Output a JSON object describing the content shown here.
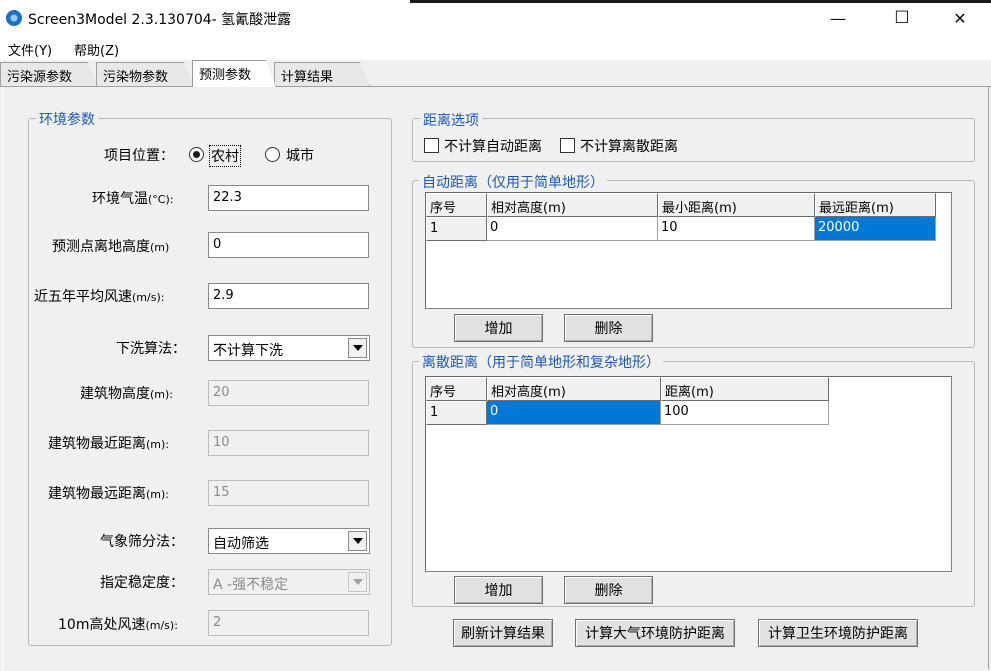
{
  "window": {
    "title": "Screen3Model 2.3.130704- 氢氰酸泄露"
  },
  "window_controls": {
    "minimize": "—",
    "maximize": "☐",
    "close": "✕"
  },
  "menu": [
    {
      "label": "文件(Y)"
    },
    {
      "label": "帮助(Z)"
    }
  ],
  "tabs": [
    {
      "label": "污染源参数"
    },
    {
      "label": "污染物参数"
    },
    {
      "label": "预测参数"
    },
    {
      "label": "计算结果"
    }
  ],
  "active_tab": "预测参数",
  "env_params": {
    "title": "环境参数",
    "location_label": "项目位置：",
    "location_options": [
      {
        "label": "农村",
        "selected": true
      },
      {
        "label": "城市",
        "selected": false
      }
    ],
    "temp_label": "环境气温",
    "temp_unit": "(°C):",
    "temp_value": "22.3",
    "height_label": "预测点离地高度",
    "height_unit": "(m)",
    "height_value": "0",
    "wind_label": "近五年平均风速",
    "wind_unit": "(m/s):",
    "wind_value": "2.9",
    "downwash_label": "下洗算法：",
    "downwash_value": "不计算下洗",
    "bldg_height_label": "建筑物高度",
    "bldg_height_unit": "(m):",
    "bldg_height_value": "20",
    "bldg_near_label": "建筑物最近距离",
    "bldg_near_unit": "(m):",
    "bldg_near_value": "10",
    "bldg_far_label": "建筑物最远距离",
    "bldg_far_unit": "(m):",
    "bldg_far_value": "15",
    "met_label": "气象筛分法：",
    "met_value": "自动筛选",
    "stability_label": "指定稳定度：",
    "stability_value": "A -强不稳定",
    "wind10_label": "10m高处风速",
    "wind10_unit": "(m/s):",
    "wind10_value": "2"
  },
  "distance_options": {
    "title": "距离选项",
    "no_auto_label": "不计算自动距离",
    "no_auto_checked": false,
    "no_discrete_label": "不计算离散距离",
    "no_discrete_checked": false
  },
  "auto_distance": {
    "title": "自动距离（仅用于简单地形）",
    "columns": [
      "序号",
      "相对高度(m)",
      "最小距离(m)",
      "最远距离(m)"
    ],
    "rows": [
      [
        "1",
        "0",
        "10",
        "20000"
      ]
    ],
    "add_label": "增加",
    "delete_label": "删除"
  },
  "discrete_distance": {
    "title": "离散距离（用于简单地形和复杂地形）",
    "columns": [
      "序号",
      "相对高度(m)",
      "距离(m)"
    ],
    "rows": [
      [
        "1",
        "0",
        "100"
      ]
    ],
    "add_label": "增加",
    "delete_label": "删除"
  },
  "bottom_buttons": {
    "refresh": "刷新计算结果",
    "atmos": "计算大气环境防护距离",
    "health": "计算卫生环境防护距离"
  },
  "colors": {
    "accent": "#1c58b5",
    "selection": "#0078d7"
  }
}
